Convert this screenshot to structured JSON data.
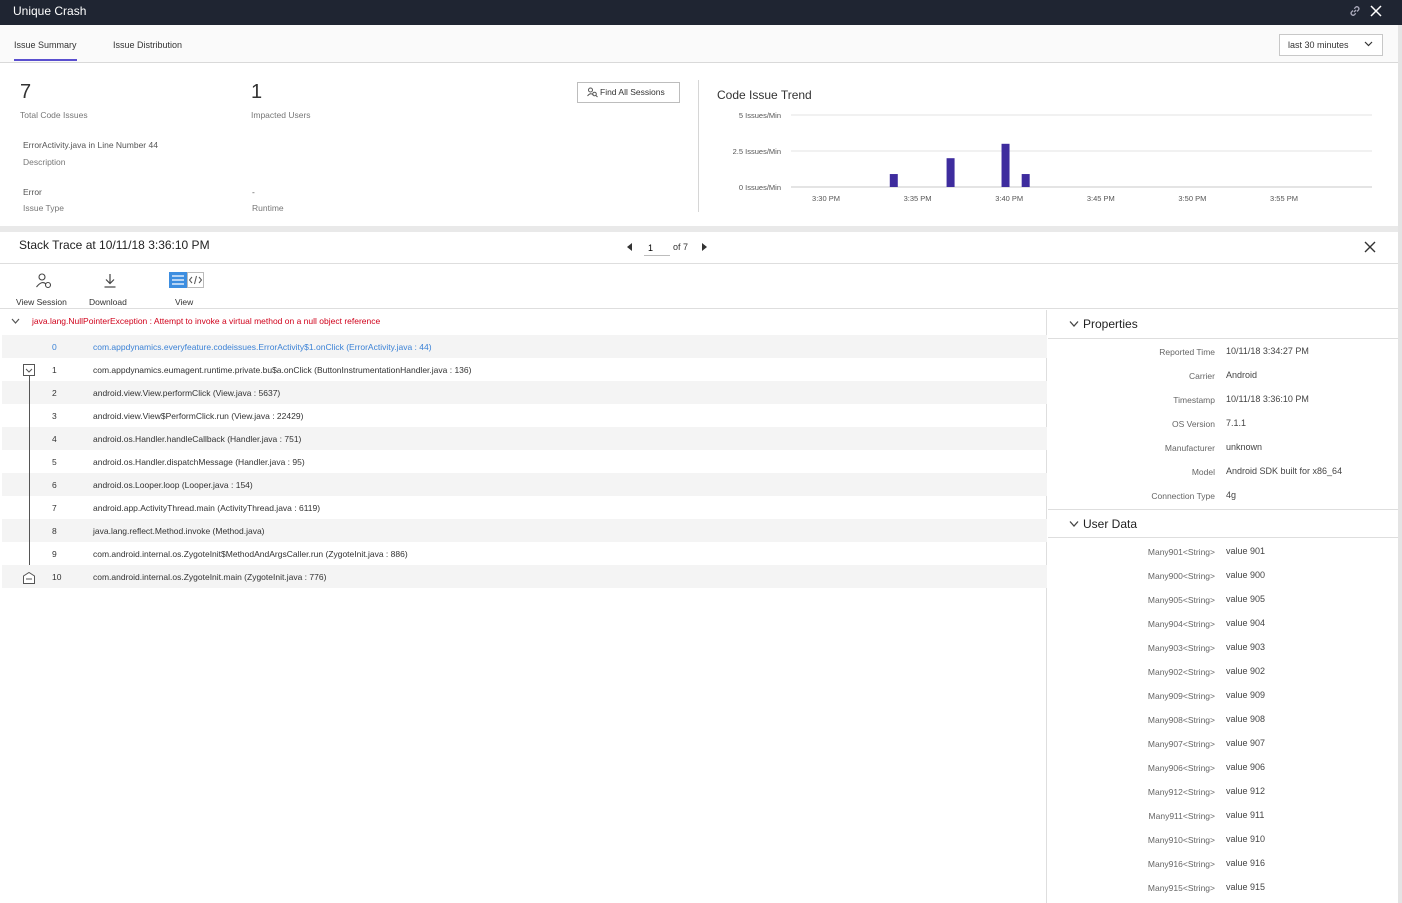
{
  "window": {
    "title": "Unique Crash"
  },
  "tabs": [
    {
      "label": "Issue Summary",
      "active": true
    },
    {
      "label": "Issue Distribution",
      "active": false
    }
  ],
  "time_range": {
    "selected": "last 30 minutes"
  },
  "summary": {
    "total_code_issues": {
      "value": "7",
      "label": "Total Code Issues"
    },
    "impacted_users": {
      "value": "1",
      "label": "Impacted Users"
    },
    "description": {
      "value": "ErrorActivity.java in Line Number 44",
      "label": "Description"
    },
    "error": {
      "label": "Error",
      "value": "-"
    },
    "issue_type": {
      "label": "Issue Type",
      "value": "Runtime"
    },
    "find_all_sessions": "Find All Sessions"
  },
  "chart_data": {
    "type": "bar",
    "title": "Code Issue Trend",
    "y_ticks": [
      "5 Issues/Min",
      "2.5 Issues/Min",
      "0 Issues/Min"
    ],
    "x_ticks": [
      "3:30 PM",
      "3:35 PM",
      "3:40 PM",
      "3:45 PM",
      "3:50 PM",
      "3:55 PM"
    ],
    "ylim": [
      0,
      5
    ],
    "bar_color": "#3e2c9e",
    "points": [
      {
        "minute": 3.7,
        "value": 0.9
      },
      {
        "minute": 6.8,
        "value": 2.0
      },
      {
        "minute": 9.8,
        "value": 3.0
      },
      {
        "minute": 10.9,
        "value": 0.9
      }
    ]
  },
  "stack_trace": {
    "title": "Stack Trace at 10/11/18 3:36:10 PM",
    "page": "1",
    "page_of": "of 7",
    "toolbar": {
      "view_session": "View Session",
      "download": "Download",
      "view": "View"
    },
    "exception": "java.lang.NullPointerException : Attempt to invoke a virtual method on a null object reference",
    "frames": [
      {
        "idx": "0",
        "text": "com.appdynamics.everyfeature.codeissues.ErrorActivity$1.onClick (ErrorActivity.java : 44)"
      },
      {
        "idx": "1",
        "text": "com.appdynamics.eumagent.runtime.private.bu$a.onClick (ButtonInstrumentationHandler.java : 136)"
      },
      {
        "idx": "2",
        "text": "android.view.View.performClick (View.java : 5637)"
      },
      {
        "idx": "3",
        "text": "android.view.View$PerformClick.run (View.java : 22429)"
      },
      {
        "idx": "4",
        "text": "android.os.Handler.handleCallback (Handler.java : 751)"
      },
      {
        "idx": "5",
        "text": "android.os.Handler.dispatchMessage (Handler.java : 95)"
      },
      {
        "idx": "6",
        "text": "android.os.Looper.loop (Looper.java : 154)"
      },
      {
        "idx": "7",
        "text": "android.app.ActivityThread.main (ActivityThread.java : 6119)"
      },
      {
        "idx": "8",
        "text": "java.lang.reflect.Method.invoke (Method.java)"
      },
      {
        "idx": "9",
        "text": "com.android.internal.os.ZygoteInit$MethodAndArgsCaller.run (ZygoteInit.java : 886)"
      },
      {
        "idx": "10",
        "text": "com.android.internal.os.ZygoteInit.main (ZygoteInit.java : 776)"
      }
    ]
  },
  "properties": {
    "header": "Properties",
    "items": [
      {
        "key": "Reported Time",
        "value": "10/11/18 3:34:27 PM"
      },
      {
        "key": "Carrier",
        "value": "Android"
      },
      {
        "key": "Timestamp",
        "value": "10/11/18 3:36:10 PM"
      },
      {
        "key": "OS Version",
        "value": "7.1.1"
      },
      {
        "key": "Manufacturer",
        "value": "unknown"
      },
      {
        "key": "Model",
        "value": "Android SDK built for x86_64"
      },
      {
        "key": "Connection Type",
        "value": "4g"
      }
    ]
  },
  "user_data": {
    "header": "User Data",
    "items": [
      {
        "key": "Many901<String>",
        "value": "value 901"
      },
      {
        "key": "Many900<String>",
        "value": "value 900"
      },
      {
        "key": "Many905<String>",
        "value": "value 905"
      },
      {
        "key": "Many904<String>",
        "value": "value 904"
      },
      {
        "key": "Many903<String>",
        "value": "value 903"
      },
      {
        "key": "Many902<String>",
        "value": "value 902"
      },
      {
        "key": "Many909<String>",
        "value": "value 909"
      },
      {
        "key": "Many908<String>",
        "value": "value 908"
      },
      {
        "key": "Many907<String>",
        "value": "value 907"
      },
      {
        "key": "Many906<String>",
        "value": "value 906"
      },
      {
        "key": "Many912<String>",
        "value": "value 912"
      },
      {
        "key": "Many911<String>",
        "value": "value 911"
      },
      {
        "key": "Many910<String>",
        "value": "value 910"
      },
      {
        "key": "Many916<String>",
        "value": "value 916"
      },
      {
        "key": "Many915<String>",
        "value": "value 915"
      }
    ]
  },
  "icons": [
    "link-icon",
    "close-icon",
    "chevron-down-icon",
    "find-sessions-icon",
    "caret-left-icon",
    "caret-right-icon",
    "view-session-icon",
    "download-icon",
    "list-view-icon",
    "code-view-icon"
  ]
}
